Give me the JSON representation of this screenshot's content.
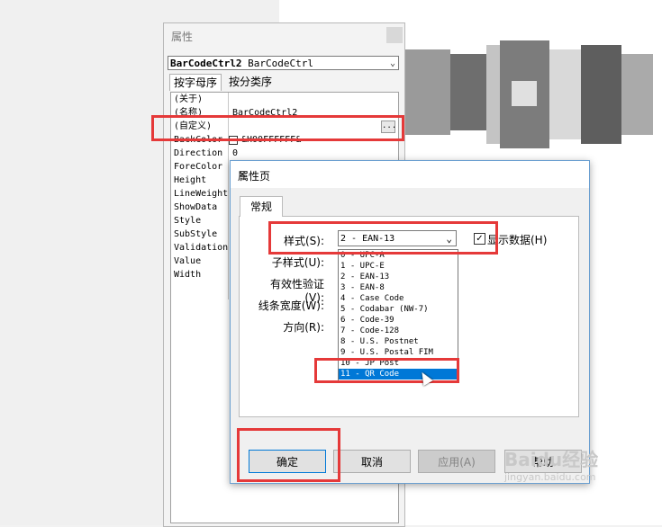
{
  "properties_window": {
    "title": "属性",
    "object_selector": {
      "name": "BarCodeCtrl2",
      "type": "BarCodeCtrl"
    },
    "tabs": [
      "按字母序",
      "按分类序"
    ],
    "rows": [
      {
        "key": "(关于)",
        "value": ""
      },
      {
        "key": "(名称)",
        "value": "BarCodeCtrl2"
      },
      {
        "key": "(自定义)",
        "value": ""
      },
      {
        "key": "BackColor",
        "value": "&H00FFFFFF&"
      },
      {
        "key": "Direction",
        "value": "0"
      },
      {
        "key": "ForeColor",
        "value": ""
      },
      {
        "key": "Height",
        "value": ""
      },
      {
        "key": "LineWeight",
        "value": ""
      },
      {
        "key": "ShowData",
        "value": ""
      },
      {
        "key": "Style",
        "value": ""
      },
      {
        "key": "SubStyle",
        "value": ""
      },
      {
        "key": "Validation",
        "value": ""
      },
      {
        "key": "Value",
        "value": ""
      },
      {
        "key": "Width",
        "value": ""
      }
    ],
    "ellipsis": "..."
  },
  "dialog": {
    "title": "属性页",
    "close_icon": "✕",
    "tab": "常规",
    "labels": {
      "style": "样式(S):",
      "substyle": "子样式(U):",
      "validation": "有效性验证(V):",
      "line_width": "线条宽度(W):",
      "direction": "方向(R):"
    },
    "style_value": "2 - EAN-13",
    "show_data_label": "显示数据(H)",
    "show_data_checked": "✓",
    "options": [
      "0 - UPC-A",
      "1 - UPC-E",
      "2 - EAN-13",
      "3 - EAN-8",
      "4 - Case Code",
      "5 - Codabar (NW-7)",
      "6 - Code-39",
      "7 - Code-128",
      "8 - U.S. Postnet",
      "9 - U.S. Postal FIM",
      "10 - JP Post",
      "11 - QR Code"
    ],
    "selected_option_index": 11,
    "buttons": {
      "ok": "确定",
      "cancel": "取消",
      "apply": "应用(A)",
      "help": "帮助"
    }
  },
  "watermark": {
    "main": "Baidu经验",
    "sub": "jingyan.baidu.com"
  },
  "colors": {
    "highlight_box": "#e53939",
    "selection": "#0078d7"
  }
}
